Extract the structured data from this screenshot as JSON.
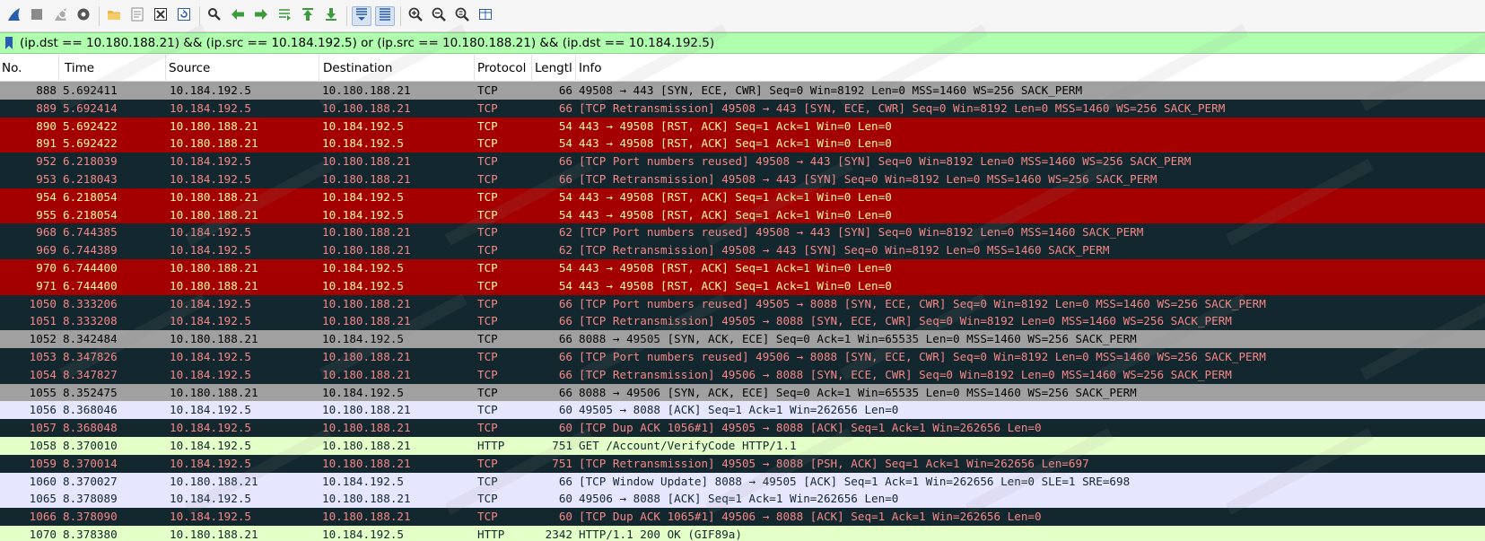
{
  "toolbar": {
    "buttons": [
      {
        "name": "start-capture-icon",
        "color": "#2a5db0"
      },
      {
        "name": "stop-capture-icon",
        "color": "#8a8a8a"
      },
      {
        "name": "restart-capture-icon",
        "color": "#8a8a8a"
      },
      {
        "name": "capture-options-icon",
        "color": "#555555"
      },
      {
        "name": "open-file-icon",
        "color": "#e8b84a"
      },
      {
        "name": "save-file-icon",
        "color": "#888888"
      },
      {
        "name": "close-file-icon",
        "color": "#333333"
      },
      {
        "name": "reload-file-icon",
        "color": "#2a5db0"
      },
      {
        "name": "find-packet-icon",
        "color": "#333333"
      },
      {
        "name": "go-back-icon",
        "color": "#3c9a3c"
      },
      {
        "name": "go-forward-icon",
        "color": "#3c9a3c"
      },
      {
        "name": "go-to-packet-icon",
        "color": "#3c9a3c"
      },
      {
        "name": "go-first-packet-icon",
        "color": "#3c9a3c"
      },
      {
        "name": "go-last-packet-icon",
        "color": "#3c9a3c"
      },
      {
        "name": "autoscroll-icon",
        "color": "#2a5db0",
        "pressed": true
      },
      {
        "name": "colorize-icon",
        "color": "#2a5db0",
        "pressed": true
      },
      {
        "name": "zoom-in-icon",
        "color": "#333333"
      },
      {
        "name": "zoom-out-icon",
        "color": "#333333"
      },
      {
        "name": "zoom-normal-icon",
        "color": "#333333"
      },
      {
        "name": "resize-columns-icon",
        "color": "#2a5db0"
      }
    ]
  },
  "filter": {
    "value": "(ip.dst == 10.180.188.21) && (ip.src == 10.184.192.5) or (ip.src == 10.180.188.21) && (ip.dst == 10.184.192.5)",
    "bg_color": "#afffaf"
  },
  "columns": {
    "no": "No.",
    "time": "Time",
    "source": "Source",
    "destination": "Destination",
    "protocol": "Protocol",
    "length": "Lengtl",
    "info": "Info"
  },
  "row_styles": {
    "tcp_normal": {
      "bg": "#a0a0a0",
      "fg": "#000000"
    },
    "tcp_bad": {
      "bg": "#12272e",
      "fg": "#f78787"
    },
    "tcp_rst": {
      "bg": "#a40000",
      "fg": "#fffc9c"
    },
    "tcp_light": {
      "bg": "#e7e6ff",
      "fg": "#12272e"
    },
    "http": {
      "bg": "#e4ffc7",
      "fg": "#12272e"
    }
  },
  "packets": [
    {
      "no": "888",
      "time": "5.692411",
      "src": "10.184.192.5",
      "dst": "10.180.188.21",
      "proto": "TCP",
      "len": "66",
      "info": "49508 → 443 [SYN, ECE, CWR] Seq=0 Win=8192 Len=0 MSS=1460 WS=256 SACK_PERM",
      "style": "tcp_normal"
    },
    {
      "no": "889",
      "time": "5.692414",
      "src": "10.184.192.5",
      "dst": "10.180.188.21",
      "proto": "TCP",
      "len": "66",
      "info": "[TCP Retransmission] 49508 → 443 [SYN, ECE, CWR] Seq=0 Win=8192 Len=0 MSS=1460 WS=256 SACK_PERM",
      "style": "tcp_bad"
    },
    {
      "no": "890",
      "time": "5.692422",
      "src": "10.180.188.21",
      "dst": "10.184.192.5",
      "proto": "TCP",
      "len": "54",
      "info": "443 → 49508 [RST, ACK] Seq=1 Ack=1 Win=0 Len=0",
      "style": "tcp_rst"
    },
    {
      "no": "891",
      "time": "5.692422",
      "src": "10.180.188.21",
      "dst": "10.184.192.5",
      "proto": "TCP",
      "len": "54",
      "info": "443 → 49508 [RST, ACK] Seq=1 Ack=1 Win=0 Len=0",
      "style": "tcp_rst"
    },
    {
      "no": "952",
      "time": "6.218039",
      "src": "10.184.192.5",
      "dst": "10.180.188.21",
      "proto": "TCP",
      "len": "66",
      "info": "[TCP Port numbers reused] 49508 → 443 [SYN] Seq=0 Win=8192 Len=0 MSS=1460 WS=256 SACK_PERM",
      "style": "tcp_bad"
    },
    {
      "no": "953",
      "time": "6.218043",
      "src": "10.184.192.5",
      "dst": "10.180.188.21",
      "proto": "TCP",
      "len": "66",
      "info": "[TCP Retransmission] 49508 → 443 [SYN] Seq=0 Win=8192 Len=0 MSS=1460 WS=256 SACK_PERM",
      "style": "tcp_bad"
    },
    {
      "no": "954",
      "time": "6.218054",
      "src": "10.180.188.21",
      "dst": "10.184.192.5",
      "proto": "TCP",
      "len": "54",
      "info": "443 → 49508 [RST, ACK] Seq=1 Ack=1 Win=0 Len=0",
      "style": "tcp_rst"
    },
    {
      "no": "955",
      "time": "6.218054",
      "src": "10.180.188.21",
      "dst": "10.184.192.5",
      "proto": "TCP",
      "len": "54",
      "info": "443 → 49508 [RST, ACK] Seq=1 Ack=1 Win=0 Len=0",
      "style": "tcp_rst"
    },
    {
      "no": "968",
      "time": "6.744385",
      "src": "10.184.192.5",
      "dst": "10.180.188.21",
      "proto": "TCP",
      "len": "62",
      "info": "[TCP Port numbers reused] 49508 → 443 [SYN] Seq=0 Win=8192 Len=0 MSS=1460 SACK_PERM",
      "style": "tcp_bad"
    },
    {
      "no": "969",
      "time": "6.744389",
      "src": "10.184.192.5",
      "dst": "10.180.188.21",
      "proto": "TCP",
      "len": "62",
      "info": "[TCP Retransmission] 49508 → 443 [SYN] Seq=0 Win=8192 Len=0 MSS=1460 SACK_PERM",
      "style": "tcp_bad"
    },
    {
      "no": "970",
      "time": "6.744400",
      "src": "10.180.188.21",
      "dst": "10.184.192.5",
      "proto": "TCP",
      "len": "54",
      "info": "443 → 49508 [RST, ACK] Seq=1 Ack=1 Win=0 Len=0",
      "style": "tcp_rst"
    },
    {
      "no": "971",
      "time": "6.744400",
      "src": "10.180.188.21",
      "dst": "10.184.192.5",
      "proto": "TCP",
      "len": "54",
      "info": "443 → 49508 [RST, ACK] Seq=1 Ack=1 Win=0 Len=0",
      "style": "tcp_rst"
    },
    {
      "no": "1050",
      "time": "8.333206",
      "src": "10.184.192.5",
      "dst": "10.180.188.21",
      "proto": "TCP",
      "len": "66",
      "info": "[TCP Port numbers reused] 49505 → 8088 [SYN, ECE, CWR] Seq=0 Win=8192 Len=0 MSS=1460 WS=256 SACK_PERM",
      "style": "tcp_bad"
    },
    {
      "no": "1051",
      "time": "8.333208",
      "src": "10.184.192.5",
      "dst": "10.180.188.21",
      "proto": "TCP",
      "len": "66",
      "info": "[TCP Retransmission] 49505 → 8088 [SYN, ECE, CWR] Seq=0 Win=8192 Len=0 MSS=1460 WS=256 SACK_PERM",
      "style": "tcp_bad"
    },
    {
      "no": "1052",
      "time": "8.342484",
      "src": "10.180.188.21",
      "dst": "10.184.192.5",
      "proto": "TCP",
      "len": "66",
      "info": "8088 → 49505 [SYN, ACK, ECE] Seq=0 Ack=1 Win=65535 Len=0 MSS=1460 WS=256 SACK_PERM",
      "style": "tcp_normal"
    },
    {
      "no": "1053",
      "time": "8.347826",
      "src": "10.184.192.5",
      "dst": "10.180.188.21",
      "proto": "TCP",
      "len": "66",
      "info": "[TCP Port numbers reused] 49506 → 8088 [SYN, ECE, CWR] Seq=0 Win=8192 Len=0 MSS=1460 WS=256 SACK_PERM",
      "style": "tcp_bad"
    },
    {
      "no": "1054",
      "time": "8.347827",
      "src": "10.184.192.5",
      "dst": "10.180.188.21",
      "proto": "TCP",
      "len": "66",
      "info": "[TCP Retransmission] 49506 → 8088 [SYN, ECE, CWR] Seq=0 Win=8192 Len=0 MSS=1460 WS=256 SACK_PERM",
      "style": "tcp_bad"
    },
    {
      "no": "1055",
      "time": "8.352475",
      "src": "10.180.188.21",
      "dst": "10.184.192.5",
      "proto": "TCP",
      "len": "66",
      "info": "8088 → 49506 [SYN, ACK, ECE] Seq=0 Ack=1 Win=65535 Len=0 MSS=1460 WS=256 SACK_PERM",
      "style": "tcp_normal"
    },
    {
      "no": "1056",
      "time": "8.368046",
      "src": "10.184.192.5",
      "dst": "10.180.188.21",
      "proto": "TCP",
      "len": "60",
      "info": "49505 → 8088 [ACK] Seq=1 Ack=1 Win=262656 Len=0",
      "style": "tcp_light"
    },
    {
      "no": "1057",
      "time": "8.368048",
      "src": "10.184.192.5",
      "dst": "10.180.188.21",
      "proto": "TCP",
      "len": "60",
      "info": "[TCP Dup ACK 1056#1] 49505 → 8088 [ACK] Seq=1 Ack=1 Win=262656 Len=0",
      "style": "tcp_bad"
    },
    {
      "no": "1058",
      "time": "8.370010",
      "src": "10.184.192.5",
      "dst": "10.180.188.21",
      "proto": "HTTP",
      "len": "751",
      "info": "GET /Account/VerifyCode HTTP/1.1",
      "style": "http"
    },
    {
      "no": "1059",
      "time": "8.370014",
      "src": "10.184.192.5",
      "dst": "10.180.188.21",
      "proto": "TCP",
      "len": "751",
      "info": "[TCP Retransmission] 49505 → 8088 [PSH, ACK] Seq=1 Ack=1 Win=262656 Len=697",
      "style": "tcp_bad"
    },
    {
      "no": "1060",
      "time": "8.370027",
      "src": "10.180.188.21",
      "dst": "10.184.192.5",
      "proto": "TCP",
      "len": "66",
      "info": "[TCP Window Update] 8088 → 49505 [ACK] Seq=1 Ack=1 Win=262656 Len=0 SLE=1 SRE=698",
      "style": "tcp_light"
    },
    {
      "no": "1065",
      "time": "8.378089",
      "src": "10.184.192.5",
      "dst": "10.180.188.21",
      "proto": "TCP",
      "len": "60",
      "info": "49506 → 8088 [ACK] Seq=1 Ack=1 Win=262656 Len=0",
      "style": "tcp_light"
    },
    {
      "no": "1066",
      "time": "8.378090",
      "src": "10.184.192.5",
      "dst": "10.180.188.21",
      "proto": "TCP",
      "len": "60",
      "info": "[TCP Dup ACK 1065#1] 49506 → 8088 [ACK] Seq=1 Ack=1 Win=262656 Len=0",
      "style": "tcp_bad"
    },
    {
      "no": "1070",
      "time": "8.378380",
      "src": "10.180.188.21",
      "dst": "10.184.192.5",
      "proto": "HTTP",
      "len": "2342",
      "info": "HTTP/1.1 200 OK  (GIF89a)",
      "style": "http"
    }
  ]
}
